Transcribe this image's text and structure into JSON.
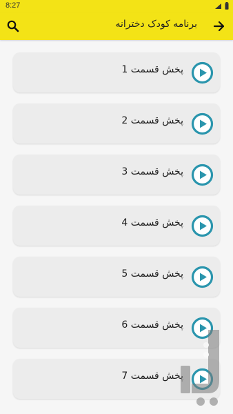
{
  "status_bar": {
    "time": "8:27"
  },
  "app_bar": {
    "title": "برنامه کودک دخترانه",
    "back_icon": "arrow-right-icon",
    "search_icon": "search-icon"
  },
  "episodes": [
    {
      "label": "پخش قسمت 1"
    },
    {
      "label": "پخش قسمت 2"
    },
    {
      "label": "پخش قسمت 3"
    },
    {
      "label": "پخش قسمت 4"
    },
    {
      "label": "پخش قسمت 5"
    },
    {
      "label": "پخش قسمت 6"
    },
    {
      "label": "پخش قسمت 7"
    }
  ],
  "colors": {
    "app_bar": "#f3e316",
    "card_bg": "#ececec",
    "play_accent": "#2a95ad"
  }
}
